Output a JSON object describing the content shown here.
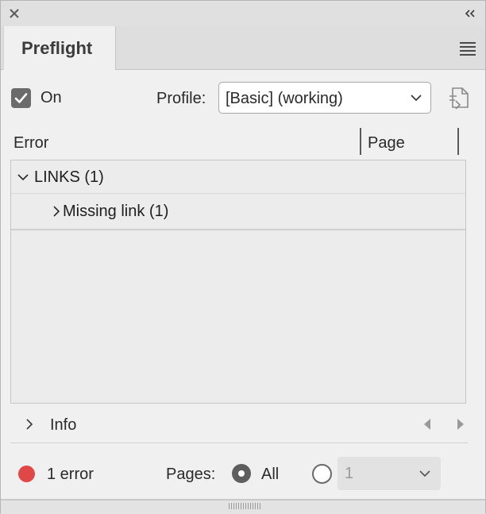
{
  "panel": {
    "tab_title": "Preflight",
    "icons": {
      "close": "close-icon",
      "collapse": "double-chevron-left-icon",
      "menu": "hamburger-menu-icon"
    }
  },
  "controls": {
    "on_checked": true,
    "on_label": "On",
    "profile_label": "Profile:",
    "profile_value": "[Basic] (working)",
    "profile_icon": "document-define-profiles-icon"
  },
  "columns": {
    "error": "Error",
    "page": "Page"
  },
  "errors": [
    {
      "label": "LINKS (1)",
      "expanded": true,
      "level": 0
    },
    {
      "label": "Missing link (1)",
      "expanded": false,
      "level": 1
    }
  ],
  "info": {
    "label": "Info",
    "expanded": false
  },
  "status": {
    "error_count_text": "1 error",
    "status_color": "#e04848"
  },
  "pages": {
    "label": "Pages:",
    "all_label": "All",
    "all_selected": true,
    "range_value": "1"
  }
}
